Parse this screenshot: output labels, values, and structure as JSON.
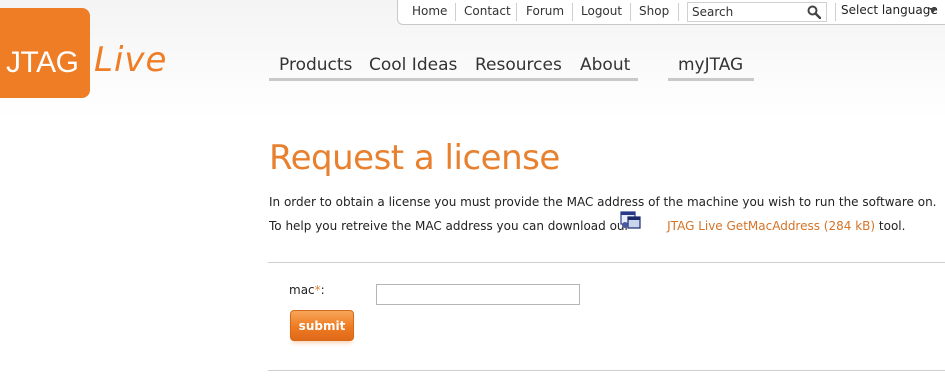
{
  "brand": {
    "logo_text_primary": "JTAG",
    "logo_text_secondary": "Live",
    "accent_color": "#ef7d25"
  },
  "utility_nav": {
    "links": [
      "Home",
      "Contact",
      "Forum",
      "Logout",
      "Shop"
    ],
    "search_placeholder": "Search",
    "search_icon": "magnifier-icon",
    "language_label": "Select language"
  },
  "main_nav": {
    "items": [
      "Products",
      "Cool Ideas",
      "Resources",
      "About"
    ],
    "account_item": "myJTAG"
  },
  "content": {
    "title": "Request a license",
    "paragraph1": "In order to obtain a license you must provide the MAC address of the machine you wish to run the software on.",
    "paragraph2_prefix": "To help you retreive the MAC address you can download our",
    "tool_link": "JTAG Live GetMacAddress (284 kB)",
    "paragraph2_suffix": "tool.",
    "tool_icon": "program-icon"
  },
  "form": {
    "mac_label": "mac",
    "required_marker": "*",
    "label_suffix": ":",
    "mac_value": "",
    "submit_label": "submit"
  }
}
